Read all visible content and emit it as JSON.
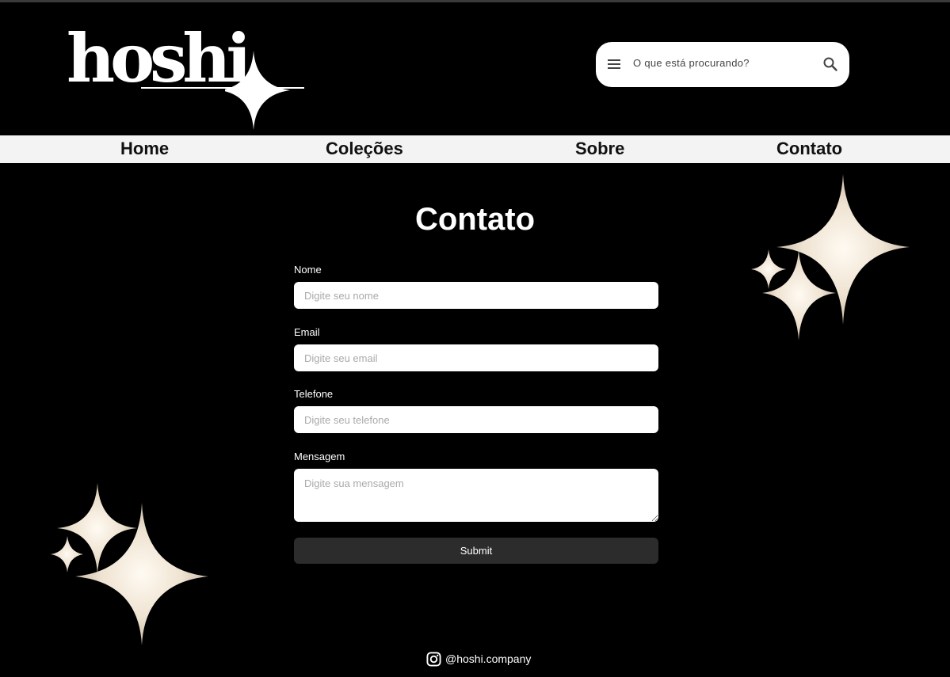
{
  "brand": {
    "logo_text": "hoshi"
  },
  "search": {
    "placeholder": "O que está procurando?"
  },
  "nav": {
    "items": [
      {
        "label": "Home"
      },
      {
        "label": "Coleções"
      },
      {
        "label": "Sobre"
      },
      {
        "label": "Contato"
      }
    ]
  },
  "page": {
    "title": "Contato"
  },
  "form": {
    "fields": [
      {
        "label": "Nome",
        "placeholder": "Digite seu nome"
      },
      {
        "label": "Email",
        "placeholder": "Digite seu email"
      },
      {
        "label": "Telefone",
        "placeholder": "Digite seu telefone"
      },
      {
        "label": "Mensagem",
        "placeholder": "Digite sua mensagem"
      }
    ],
    "submit_label": "Submit"
  },
  "footer": {
    "instagram_handle": "@hoshi.company"
  },
  "colors": {
    "background": "#000000",
    "nav_background": "#f3f3f3",
    "submit_background": "#2c2c2c",
    "sparkle": "#efe3d2"
  },
  "icons": [
    "menu-icon",
    "search-icon",
    "instagram-icon",
    "sparkle-icon"
  ]
}
